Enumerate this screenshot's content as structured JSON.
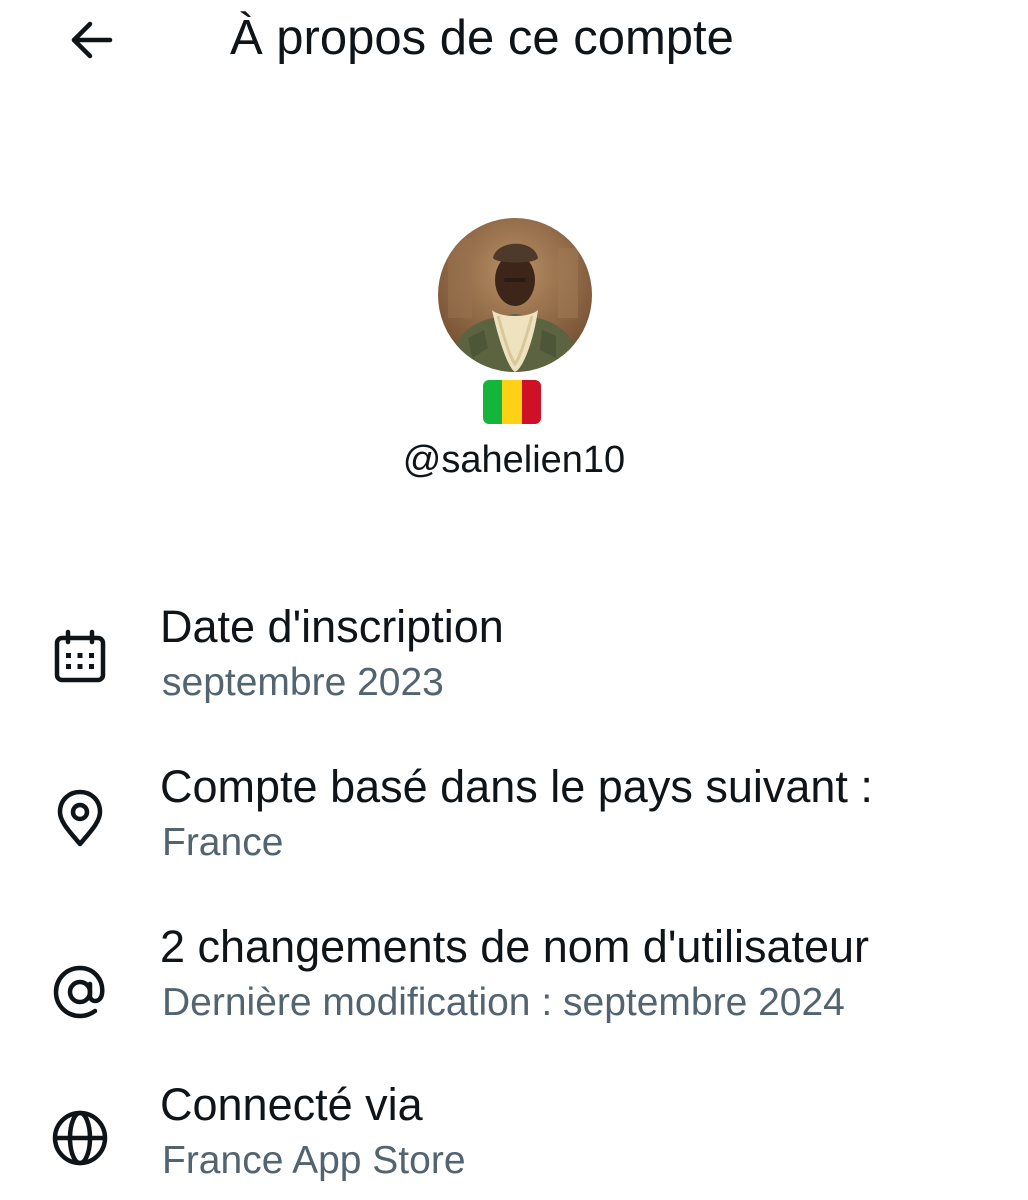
{
  "header": {
    "back_icon": "arrow-left-icon",
    "title": "À propos de ce compte"
  },
  "profile": {
    "avatar": "avatar-photo",
    "flag": {
      "icon": "mali-flag-icon",
      "colors": [
        "#14b53a",
        "#fcd116",
        "#ce1126"
      ]
    },
    "handle": "@sahelien10"
  },
  "info": [
    {
      "icon": "calendar-icon",
      "title": "Date d'inscription",
      "subtitle": "septembre 2023"
    },
    {
      "icon": "location-pin-icon",
      "title": "Compte basé dans le pays suivant :",
      "subtitle": "France"
    },
    {
      "icon": "at-sign-icon",
      "title": "2 changements de nom d'utilisateur",
      "subtitle": "Dernière modification : septembre 2024"
    },
    {
      "icon": "globe-icon",
      "title": "Connecté via",
      "subtitle": "France App Store"
    }
  ],
  "colors": {
    "primary_text": "#0f1419",
    "secondary_text": "#536471",
    "background": "#ffffff"
  }
}
